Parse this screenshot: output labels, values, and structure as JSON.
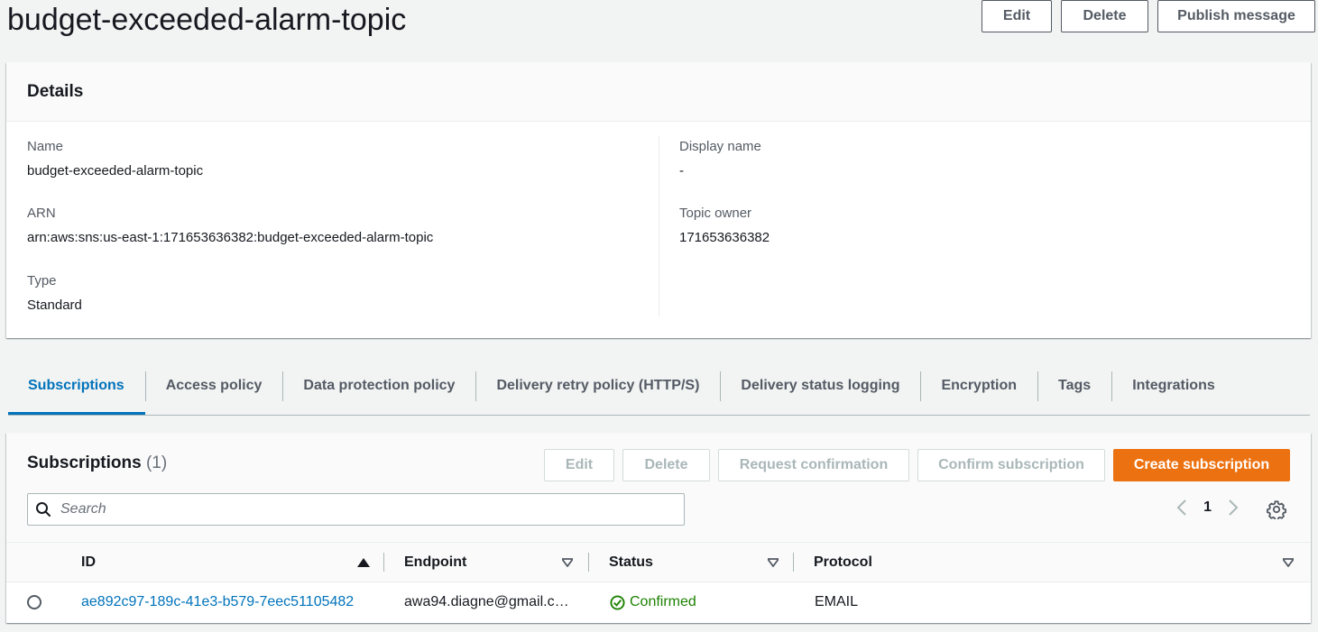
{
  "header": {
    "title": "budget-exceeded-alarm-topic",
    "actions": {
      "edit": "Edit",
      "delete": "Delete",
      "publish": "Publish message"
    }
  },
  "details": {
    "title": "Details",
    "name_label": "Name",
    "name_value": "budget-exceeded-alarm-topic",
    "arn_label": "ARN",
    "arn_value": "arn:aws:sns:us-east-1:171653636382:budget-exceeded-alarm-topic",
    "type_label": "Type",
    "type_value": "Standard",
    "display_name_label": "Display name",
    "display_name_value": "-",
    "topic_owner_label": "Topic owner",
    "topic_owner_value": "171653636382"
  },
  "tabs": [
    {
      "label": "Subscriptions"
    },
    {
      "label": "Access policy"
    },
    {
      "label": "Data protection policy"
    },
    {
      "label": "Delivery retry policy (HTTP/S)"
    },
    {
      "label": "Delivery status logging"
    },
    {
      "label": "Encryption"
    },
    {
      "label": "Tags"
    },
    {
      "label": "Integrations"
    }
  ],
  "subscriptions": {
    "title": "Subscriptions",
    "count": "(1)",
    "actions": {
      "edit": "Edit",
      "delete": "Delete",
      "request_confirmation": "Request confirmation",
      "confirm_subscription": "Confirm subscription",
      "create_subscription": "Create subscription"
    },
    "search_placeholder": "Search",
    "page_number": "1",
    "columns": {
      "id": "ID",
      "endpoint": "Endpoint",
      "status": "Status",
      "protocol": "Protocol"
    },
    "rows": [
      {
        "id": "ae892c97-189c-41e3-b579-7eec51105482",
        "endpoint": "awa94.diagne@gmail.c…",
        "status": "Confirmed",
        "protocol": "EMAIL"
      }
    ]
  },
  "colors": {
    "accent": "#0073bb",
    "primary_button": "#ec7211",
    "success": "#1d8102"
  }
}
